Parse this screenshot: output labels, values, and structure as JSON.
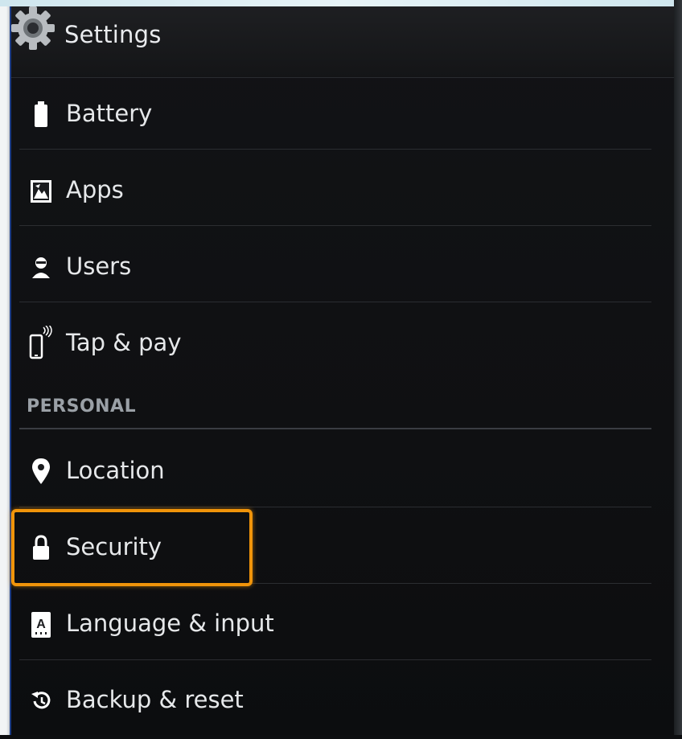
{
  "header": {
    "title": "Settings",
    "icon": "gear-icon"
  },
  "items_top": [
    {
      "label": "Battery",
      "icon": "battery-icon"
    },
    {
      "label": "Apps",
      "icon": "apps-icon"
    },
    {
      "label": "Users",
      "icon": "user-icon"
    },
    {
      "label": "Tap & pay",
      "icon": "nfc-phone-icon"
    }
  ],
  "section": {
    "label": "PERSONAL"
  },
  "items_personal": [
    {
      "label": "Location",
      "icon": "location-pin-icon"
    },
    {
      "label": "Security",
      "icon": "lock-icon"
    },
    {
      "label": "Language & input",
      "icon": "keyboard-a-icon"
    },
    {
      "label": "Backup & reset",
      "icon": "backup-restore-icon"
    }
  ],
  "highlight": {
    "target": "Security",
    "color": "#f0940a"
  },
  "colors": {
    "background": "#0d0e10",
    "text": "#e6e8ea",
    "section": "#9aa0a6",
    "side_accent": "#1e3f8a"
  }
}
